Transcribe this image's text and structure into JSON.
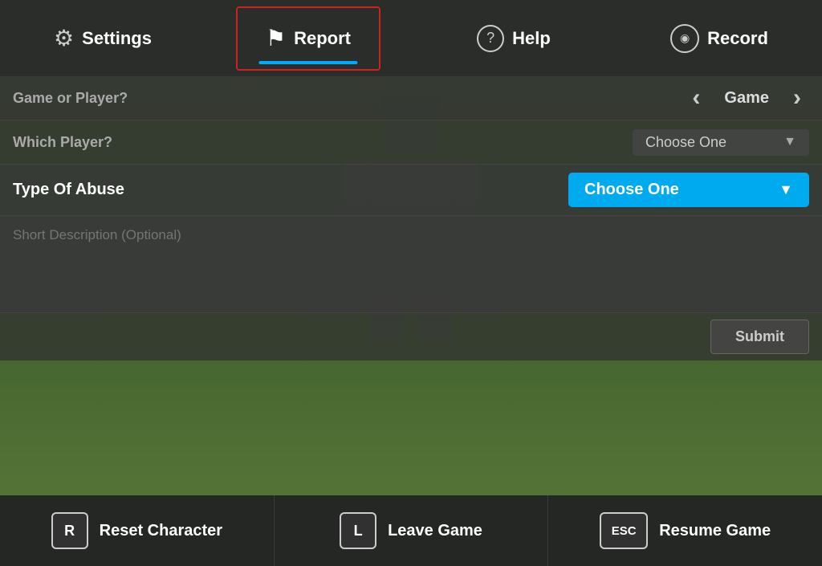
{
  "topBar": {
    "settings": {
      "label": "Settings",
      "icon": "⚙"
    },
    "report": {
      "label": "Report",
      "icon": "⚑",
      "active": true
    },
    "help": {
      "label": "Help",
      "icon": "?"
    },
    "record": {
      "label": "Record",
      "icon": "◎"
    }
  },
  "form": {
    "gameOrPlayer": {
      "label": "Game or Player?",
      "value": "Game"
    },
    "whichPlayer": {
      "label": "Which Player?",
      "placeholder": "Choose One"
    },
    "typeOfAbuse": {
      "label": "Type Of Abuse",
      "dropdownText": "Choose One"
    },
    "description": {
      "placeholder": "Short Description (Optional)"
    },
    "submitBtn": "Submit"
  },
  "bottomBar": {
    "resetCharacter": {
      "key": "R",
      "label": "Reset Character"
    },
    "leaveGame": {
      "key": "L",
      "label": "Leave Game"
    },
    "resumeGame": {
      "key": "ESC",
      "label": "Resume Game"
    }
  }
}
